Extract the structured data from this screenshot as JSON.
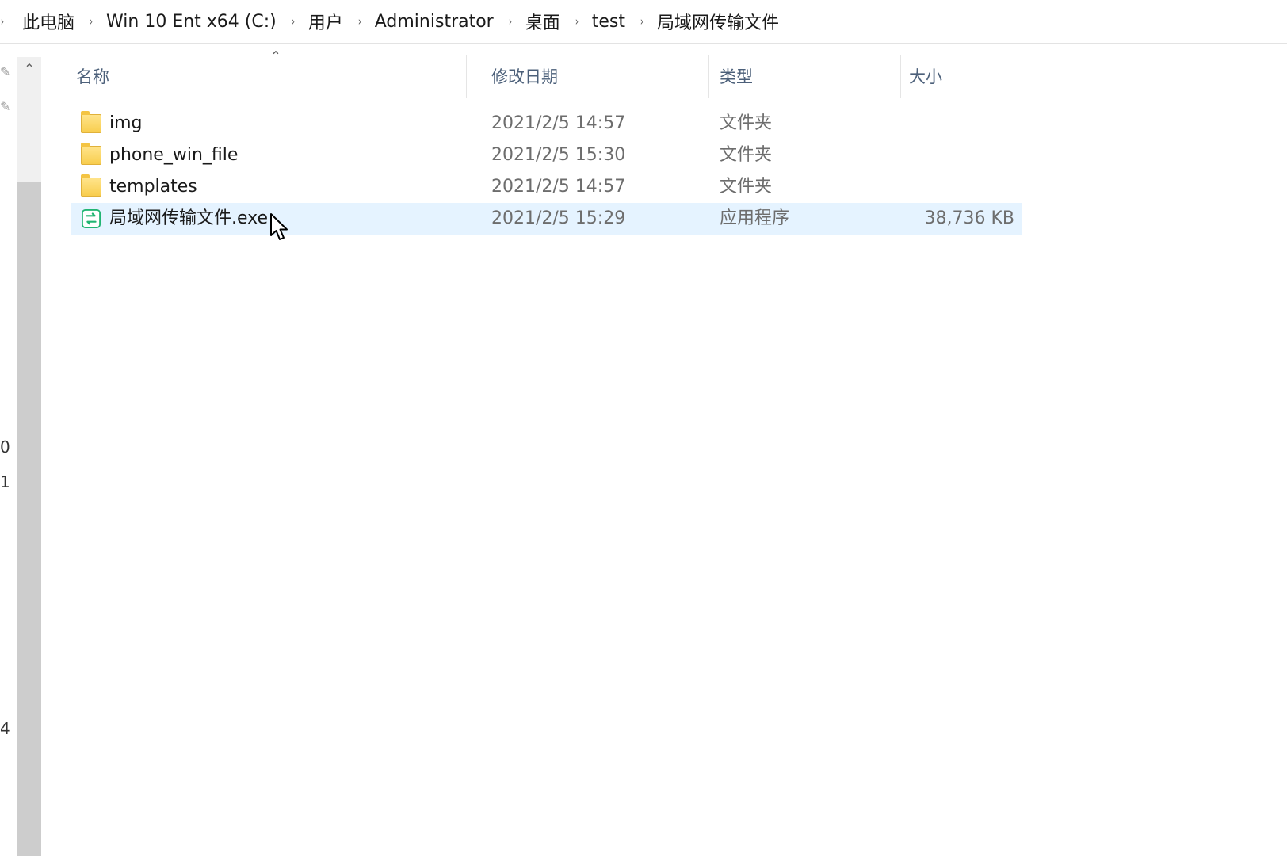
{
  "breadcrumb": [
    "此电脑",
    "Win 10 Ent x64 (C:)",
    "用户",
    "Administrator",
    "桌面",
    "test",
    "局域网传输文件"
  ],
  "columns": {
    "name": "名称",
    "date": "修改日期",
    "type": "类型",
    "size": "大小"
  },
  "files": [
    {
      "name": "img",
      "date": "2021/2/5 14:57",
      "type": "文件夹",
      "size": "",
      "icon": "folder-icon"
    },
    {
      "name": "phone_win_file",
      "date": "2021/2/5 15:30",
      "type": "文件夹",
      "size": "",
      "icon": "folder-icon"
    },
    {
      "name": "templates",
      "date": "2021/2/5 14:57",
      "type": "文件夹",
      "size": "",
      "icon": "folder-icon"
    },
    {
      "name": "局域网传输文件.exe",
      "date": "2021/2/5 15:29",
      "type": "应用程序",
      "size": "38,736 KB",
      "icon": "app-exe-icon",
      "selected": true
    }
  ],
  "navpane_fragments": [
    "0",
    "1",
    "4"
  ]
}
